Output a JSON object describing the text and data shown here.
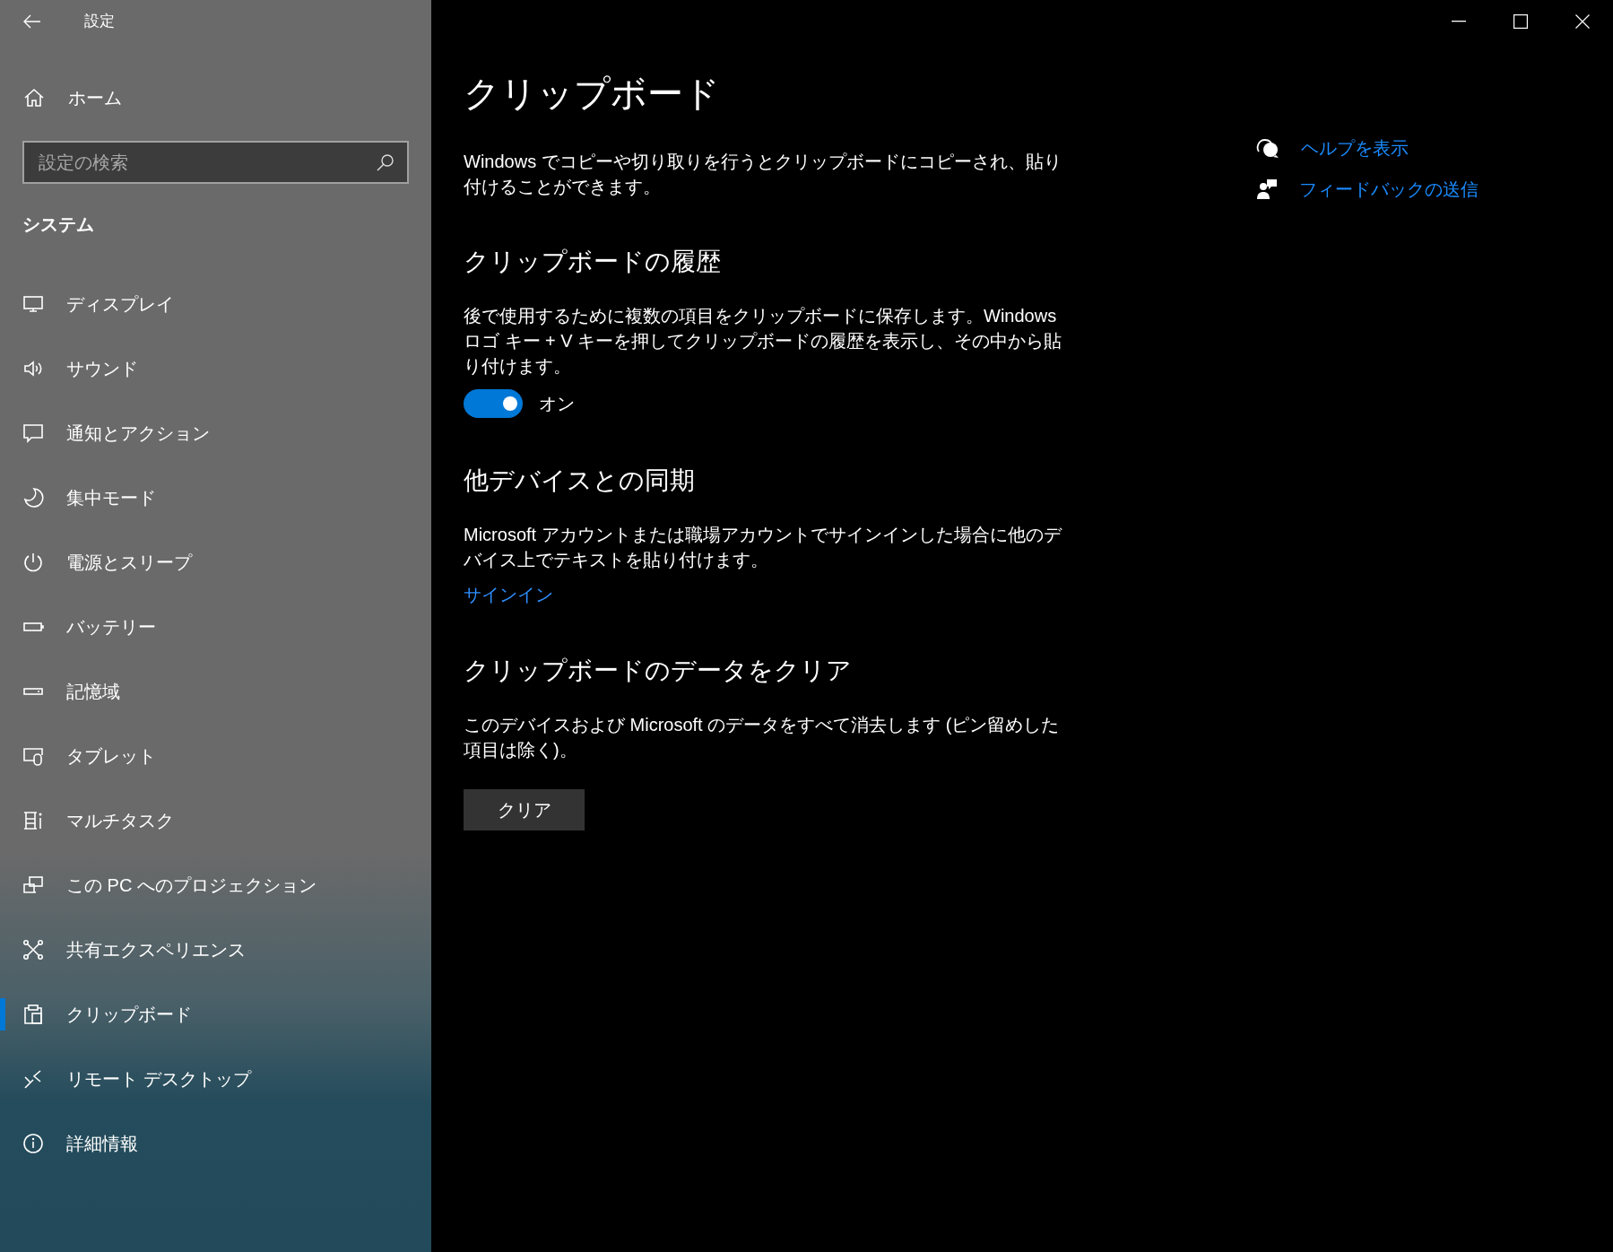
{
  "window": {
    "title": "設定"
  },
  "sidebar": {
    "home": "ホーム",
    "search": {
      "placeholder": "設定の検索"
    },
    "section": "システム",
    "items": [
      {
        "label": "ディスプレイ",
        "selected": false
      },
      {
        "label": "サウンド",
        "selected": false
      },
      {
        "label": "通知とアクション",
        "selected": false
      },
      {
        "label": "集中モード",
        "selected": false
      },
      {
        "label": "電源とスリープ",
        "selected": false
      },
      {
        "label": "バッテリー",
        "selected": false
      },
      {
        "label": "記憶域",
        "selected": false
      },
      {
        "label": "タブレット",
        "selected": false
      },
      {
        "label": "マルチタスク",
        "selected": false
      },
      {
        "label": "この PC へのプロジェクション",
        "selected": false
      },
      {
        "label": "共有エクスペリエンス",
        "selected": false
      },
      {
        "label": "クリップボード",
        "selected": true
      },
      {
        "label": "リモート デスクトップ",
        "selected": false
      },
      {
        "label": "詳細情報",
        "selected": false
      }
    ]
  },
  "page": {
    "title": "クリップボード",
    "intro": "Windows でコピーや切り取りを行うとクリップボードにコピーされ、貼り付けることができます。",
    "sections": [
      {
        "kind": "toggle",
        "heading": "クリップボードの履歴",
        "text": "後で使用するために複数の項目をクリップボードに保存します。Windows ロゴ キー + V キーを押してクリップボードの履歴を表示し、その中から貼り付けます。",
        "on": true,
        "state_label": "オン"
      },
      {
        "kind": "link",
        "heading": "他デバイスとの同期",
        "text": "Microsoft アカウントまたは職場アカウントでサインインした場合に他のデバイス上でテキストを貼り付けます。",
        "link": "サインイン"
      },
      {
        "kind": "button",
        "heading": "クリップボードのデータをクリア",
        "text": "このデバイスおよび Microsoft のデータをすべて消去します (ピン留めした項目は除く)。",
        "button": "クリア"
      }
    ]
  },
  "help_links": [
    {
      "label": "ヘルプを表示"
    },
    {
      "label": "フィードバックの送信"
    }
  ]
}
